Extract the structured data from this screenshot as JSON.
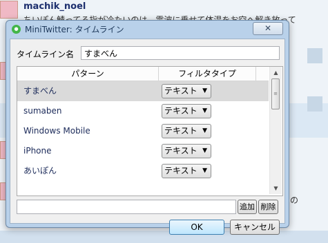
{
  "background": {
    "username": "machik_noel",
    "tweet_text": "ちいぽん鯖ってる指が冷たいのは、電波に乗せて体温をお空へ解き放って",
    "side_text": "の"
  },
  "dialog": {
    "title": "MiniTwitter: タイムライン",
    "close_label": "✕",
    "timeline_name_label": "タイムライン名",
    "timeline_name_value": "すまべん",
    "columns": {
      "pattern": "パターン",
      "filter_type": "フィルタタイプ"
    },
    "rows": [
      {
        "pattern": "すまべん",
        "type": "テキスト",
        "selected": true
      },
      {
        "pattern": "sumaben",
        "type": "テキスト",
        "selected": false
      },
      {
        "pattern": "Windows Mobile",
        "type": "テキスト",
        "selected": false
      },
      {
        "pattern": "iPhone",
        "type": "テキスト",
        "selected": false
      },
      {
        "pattern": "あいぽん",
        "type": "テキスト",
        "selected": false
      }
    ],
    "new_pattern_value": "",
    "add_label": "追加",
    "delete_label": "削除",
    "ok_label": "OK",
    "cancel_label": "キャンセル"
  },
  "colors": {
    "title_bar": "#b9d1ea",
    "selected_row": "#dadada",
    "app_icon": "#43b649"
  }
}
